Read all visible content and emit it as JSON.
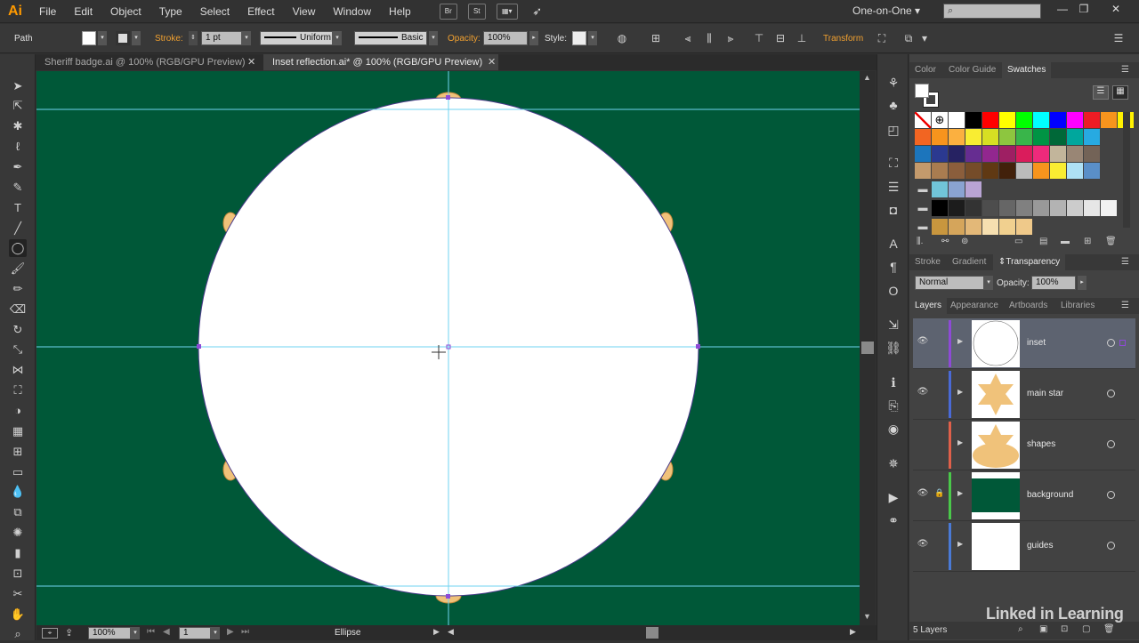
{
  "app": {
    "logo": "Ai"
  },
  "menu": [
    "File",
    "Edit",
    "Object",
    "Type",
    "Select",
    "Effect",
    "View",
    "Window",
    "Help"
  ],
  "appbar_buttons": [
    "Br",
    "St"
  ],
  "workspace": "One-on-One",
  "control": {
    "selection_type": "Path",
    "stroke_label": "Stroke:",
    "stroke_weight": "1 pt",
    "profile": "Uniform",
    "brush": "Basic",
    "opacity_label": "Opacity:",
    "opacity": "100%",
    "style_label": "Style:",
    "transform_label": "Transform"
  },
  "doc_tabs": [
    {
      "label": "Sheriff badge.ai @ 100% (RGB/GPU Preview)",
      "active": false
    },
    {
      "label": "Inset reflection.ai* @ 100% (RGB/GPU Preview)",
      "active": true
    }
  ],
  "status": {
    "zoom": "100%",
    "artboard": "1",
    "tool": "Ellipse"
  },
  "panels": {
    "color_tabs": [
      "Color",
      "Color Guide",
      "Swatches"
    ],
    "active_color_tab": "Swatches",
    "swatch_colors": [
      [
        "#ff0000",
        "#ffff00",
        "#00ff00",
        "#00ffff",
        "#0000ff",
        "#ff00ff",
        "#ed1c24",
        "#f7941d",
        "#fff200"
      ],
      [
        "#f26522",
        "#f7941d",
        "#fbb040",
        "#f9ed32",
        "#d7df23",
        "#8dc63f",
        "#39b54a",
        "#009444",
        "#006838",
        "#00a79d",
        "#27aae1"
      ],
      [
        "#1c75bc",
        "#2b3990",
        "#262262",
        "#662d91",
        "#92278f",
        "#9e1f63",
        "#da1c5c",
        "#ee2a7b",
        "#c2b59b",
        "#998675",
        "#736357"
      ],
      [
        "#c49a6c",
        "#a97c50",
        "#8b5e3c",
        "#754c29",
        "#603913",
        "#42210b"
      ]
    ],
    "group_row_1": [
      "#71c5d9",
      "#8aa3d1",
      "#b9a4d4"
    ],
    "group_row_2": [
      "#000000",
      "#1c1c1c",
      "#333333",
      "#4d4d4d",
      "#666666",
      "#808080",
      "#999999",
      "#b3b3b3",
      "#cccccc",
      "#e6e6e6",
      "#f2f2f2"
    ],
    "group_row_3": [
      "#c8963e",
      "#d5a55b",
      "#e3b878",
      "#f6dfb0",
      "#f1d08f",
      "#efc98a"
    ],
    "mid_tabs": [
      "Stroke",
      "Gradient",
      "Transparency"
    ],
    "active_mid_tab": "Transparency",
    "blend_mode": "Normal",
    "opacity_label": "Opacity:",
    "opacity": "100%",
    "layer_tabs": [
      "Layers",
      "Appearance",
      "Artboards",
      "Libraries"
    ],
    "active_layer_tab": "Layers",
    "layers": [
      {
        "name": "inset",
        "color": "#8e4ad6",
        "visible": true,
        "locked": false,
        "selected": true
      },
      {
        "name": "main star",
        "color": "#4a6ad6",
        "visible": true,
        "locked": false,
        "selected": false
      },
      {
        "name": "shapes",
        "color": "#e0604a",
        "visible": false,
        "locked": false,
        "selected": false
      },
      {
        "name": "background",
        "color": "#4ac84a",
        "visible": true,
        "locked": true,
        "selected": false
      },
      {
        "name": "guides",
        "color": "#4a7ad6",
        "visible": true,
        "locked": false,
        "selected": false
      }
    ],
    "layer_count": "5 Layers"
  },
  "canvas": {
    "background_color": "#005838",
    "ellipse_fill": "#ffffff",
    "guide_color": "#6fd3f0",
    "star_color": "#f0c27a"
  },
  "watermark": "Linked in Learning"
}
